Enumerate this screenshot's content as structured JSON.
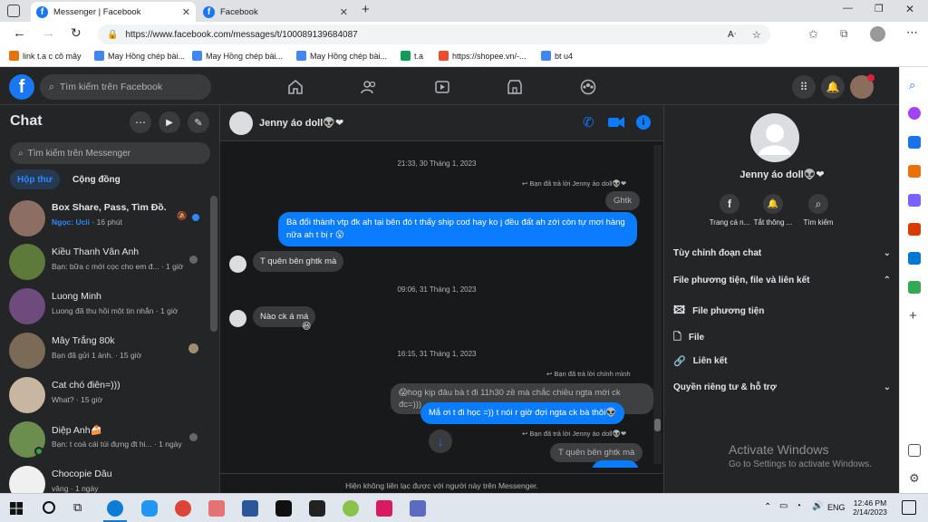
{
  "browser": {
    "tabs": [
      {
        "title": "Messenger | Facebook",
        "active": true
      },
      {
        "title": "Facebook",
        "active": false
      }
    ],
    "url": "https://www.facebook.com/messages/t/100089139684087",
    "bookmarks": [
      "link t.a c cô mây",
      "May Hồng chép bài...",
      "May Hồng chép bài...",
      "May Hồng chép bài...",
      "t.a",
      "https://shopee.vn/-...",
      "bt u4"
    ]
  },
  "fb": {
    "search_placeholder": "Tìm kiếm trên Facebook",
    "chat_title": "Chat",
    "messenger_search_placeholder": "Tìm kiếm trên Messenger",
    "tabs": [
      "Hộp thư",
      "Cộng đồng"
    ],
    "chats": [
      {
        "name": "Box Share, Pass, Tìm Đồ.",
        "preview_sender": "Ngọc: Ucii",
        "preview_time": " · 16 phút",
        "unread": true,
        "color": "#8d6e63"
      },
      {
        "name": "Kiều Thanh Vân Anh",
        "preview": "Bạn: bữa c mới cọc cho em đ... · 1 giờ",
        "color": "#5d7a3a"
      },
      {
        "name": "Luong Minh",
        "preview": "Luong đã thu hồi một tin nhắn · 1 giờ",
        "color": "#6d4c7d"
      },
      {
        "name": "Mây Trắng 80k",
        "preview": "Bạn đã gửi 1 ảnh. · 15 giờ",
        "color": "#7b6a55"
      },
      {
        "name": "Cat chó điên=)))",
        "preview": "What? · 15 giờ",
        "color": "#c9b6a0"
      },
      {
        "name": "Diệp Anh🍰",
        "preview": "Bạn: t coá cái túi đựng đt hi... · 1 ngày",
        "color": "#6b8e4e"
      },
      {
        "name": "Chocopie Dâu",
        "preview": "vâng · 1 ngày",
        "color": "#f0f0f0"
      }
    ]
  },
  "conversation": {
    "contact_name": "Jenny áo doll👽❤",
    "footer": "Hiện không liên lạc được với người này trên Messenger.",
    "items": [
      {
        "kind": "ts",
        "text": "21:33, 30 Tháng 1, 2023"
      },
      {
        "kind": "reply",
        "text": "↩ Bạn đã trả lời Jenny áo doll👽❤"
      },
      {
        "kind": "quote",
        "text": "Ghtk"
      },
      {
        "kind": "out",
        "text": "Bà đổi thành vtp đk ah tại bên đó t thấy ship cod hay ko j đều đất ah zới còn tự mơi hàng nữa ah t bị r 😮"
      },
      {
        "kind": "in",
        "text": "T quên bên ghtk mà"
      },
      {
        "kind": "ts",
        "text": "09:06, 31 Tháng 1, 2023"
      },
      {
        "kind": "in",
        "text": "Nào ck á má"
      },
      {
        "kind": "reaction",
        "text": "😆"
      },
      {
        "kind": "ts",
        "text": "16:15, 31 Tháng 1, 2023"
      },
      {
        "kind": "reply",
        "text": "↩ Bạn đã trả lời chính mình"
      },
      {
        "kind": "quote",
        "text": "😱hog kịp đâu bà t đi 11h30 zề mà chắc chiều ngta mới ck đc=)))"
      },
      {
        "kind": "out",
        "text": "Mắ ơi t đi học =)) t nói r giờ đợi ngta ck bà thôi👽"
      },
      {
        "kind": "reply",
        "text": "↩ Bạn đã trả lời Jenny áo doll👽❤"
      },
      {
        "kind": "quote",
        "text": "T quên bên ghtk mà"
      }
    ]
  },
  "info": {
    "name": "Jenny áo doll👽❤",
    "actions": [
      "Trang cá n...",
      "Tắt thông ...",
      "Tìm kiếm"
    ],
    "sections": [
      "Tùy chỉnh đoạn chat",
      "File phương tiện, file và liên kết"
    ],
    "sub_items": [
      "File phương tiện",
      "File",
      "Liên kết"
    ],
    "privacy": "Quyền riêng tư & hỗ trợ"
  },
  "watermark": {
    "line1": "Activate Windows",
    "line2": "Go to Settings to activate Windows."
  },
  "taskbar": {
    "time": "12:46 PM",
    "date": "2/14/2023",
    "lang": "ENG"
  }
}
